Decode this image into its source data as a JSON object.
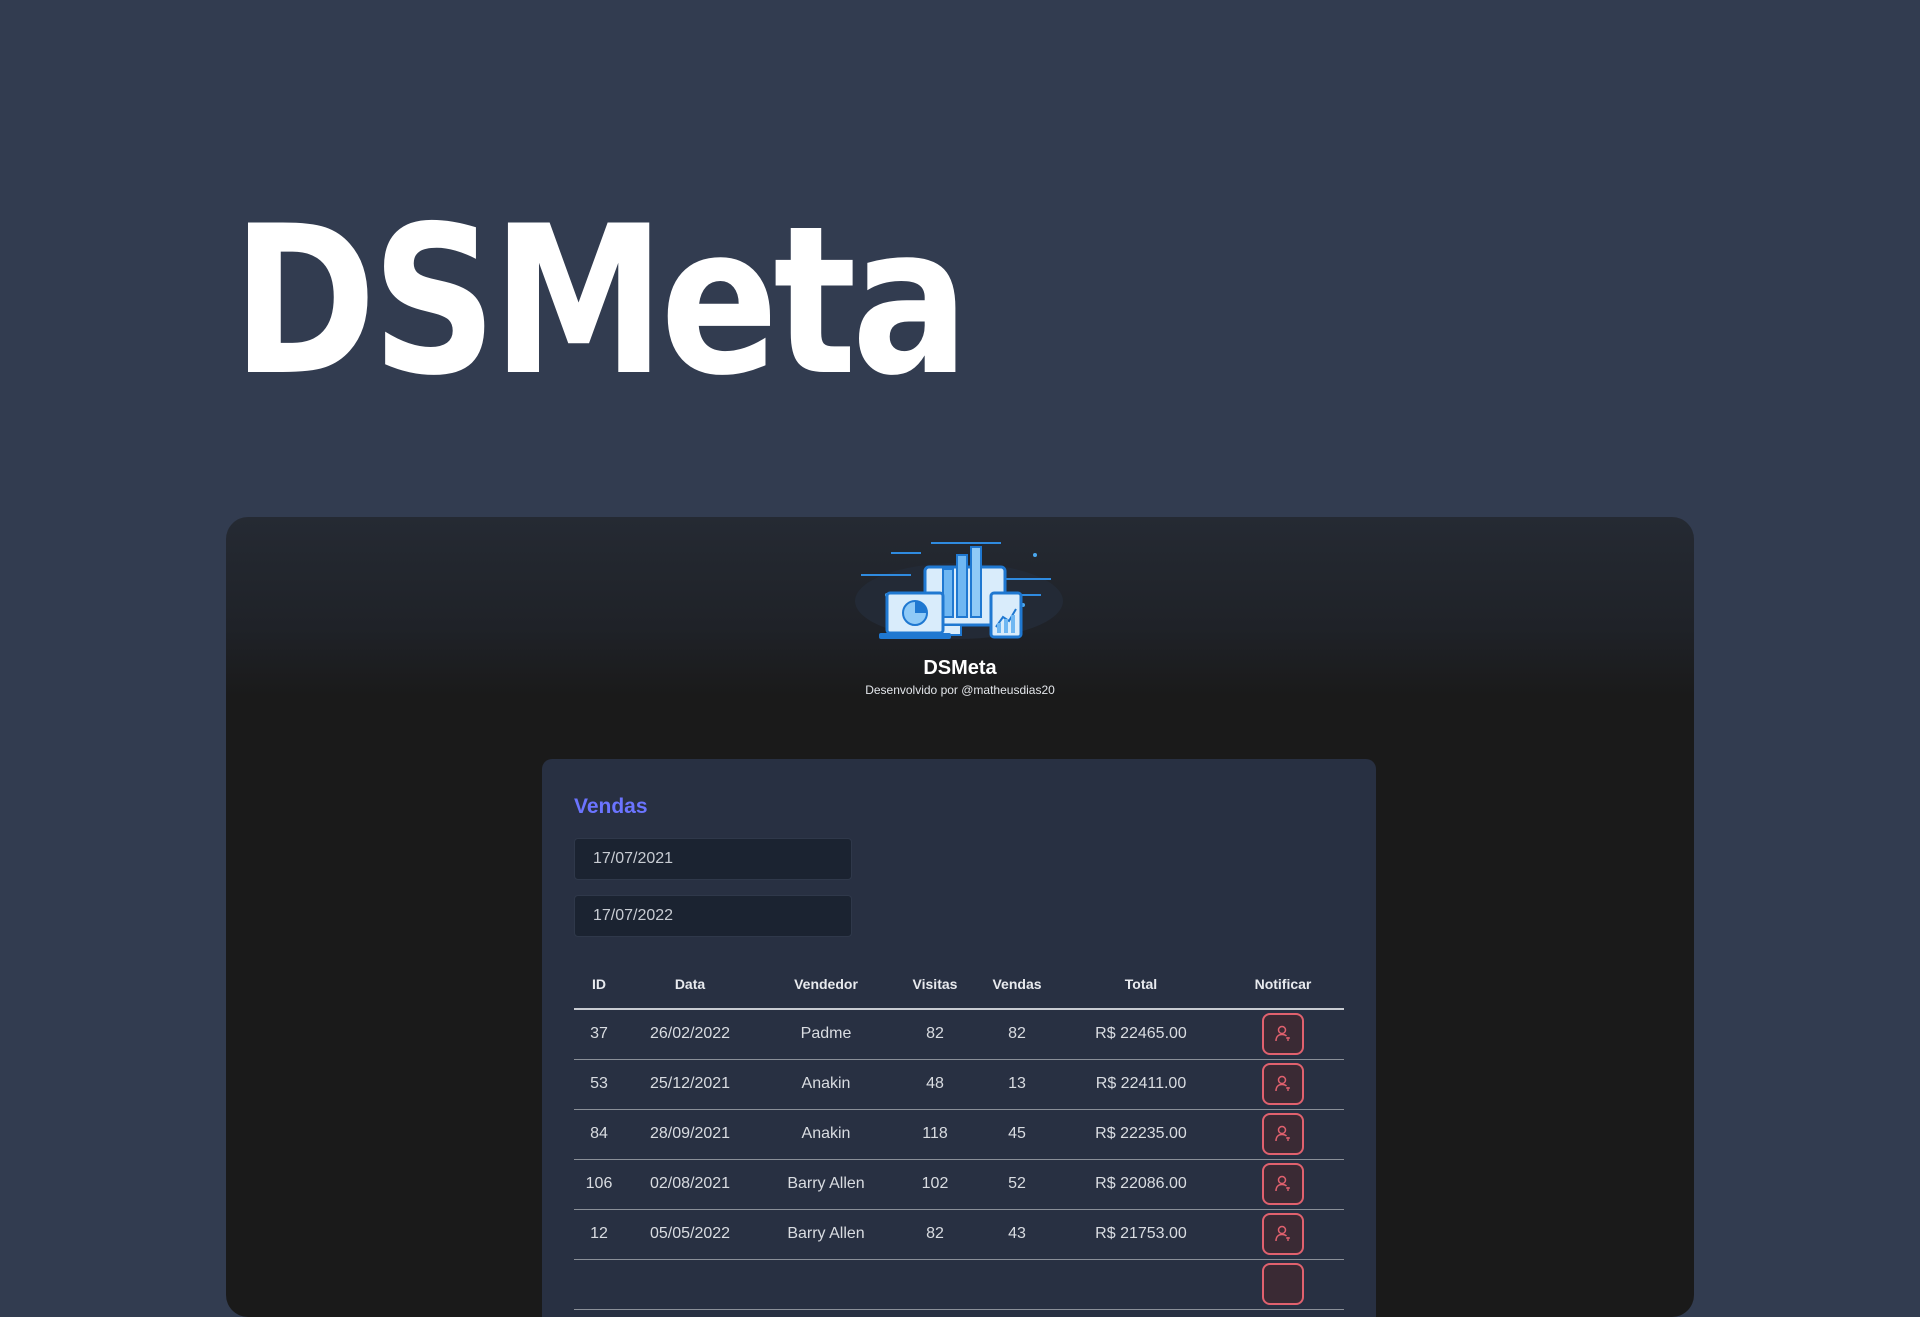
{
  "hero": {
    "title": "DSMeta"
  },
  "app": {
    "brand_name": "DSMeta",
    "brand_subtitle": "Desenvolvido por @matheusdias20",
    "card_title": "Vendas",
    "min_date": "17/07/2021",
    "max_date": "17/07/2022"
  },
  "table": {
    "headers": [
      "ID",
      "Data",
      "Vendedor",
      "Visitas",
      "Vendas",
      "Total",
      "Notificar"
    ],
    "rows": [
      {
        "id": "37",
        "date": "26/02/2022",
        "seller": "Padme",
        "visits": "82",
        "deals": "82",
        "total": "R$ 22465.00"
      },
      {
        "id": "53",
        "date": "25/12/2021",
        "seller": "Anakin",
        "visits": "48",
        "deals": "13",
        "total": "R$ 22411.00"
      },
      {
        "id": "84",
        "date": "28/09/2021",
        "seller": "Anakin",
        "visits": "118",
        "deals": "45",
        "total": "R$ 22235.00"
      },
      {
        "id": "106",
        "date": "02/08/2021",
        "seller": "Barry Allen",
        "visits": "102",
        "deals": "52",
        "total": "R$ 22086.00"
      },
      {
        "id": "12",
        "date": "05/05/2022",
        "seller": "Barry Allen",
        "visits": "82",
        "deals": "43",
        "total": "R$ 21753.00"
      }
    ]
  },
  "colors": {
    "background": "#323c50",
    "card": "#283042",
    "accent": "#6b74ff",
    "notify": "#e0616e"
  },
  "icons": {
    "logo": "dashboard-devices-illustration",
    "notify": "user-notify-icon"
  }
}
